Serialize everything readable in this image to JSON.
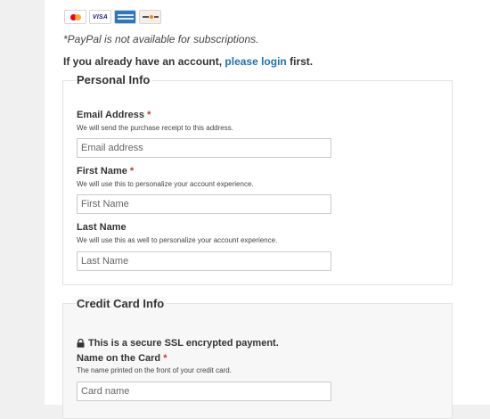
{
  "payment_methods": [
    {
      "name": "mastercard-icon"
    },
    {
      "name": "visa-icon",
      "text": "VISA"
    },
    {
      "name": "amex-icon"
    },
    {
      "name": "discover-icon"
    }
  ],
  "paypal_note": "*PayPal is not available for subscriptions.",
  "login": {
    "prefix": "If you already have an account,",
    "link": "please login",
    "suffix": "first."
  },
  "personal_info": {
    "title": "Personal Info",
    "fields": [
      {
        "label": "Email Address",
        "required": "*",
        "description": "We will send the purchase receipt to this address.",
        "placeholder": "Email address"
      },
      {
        "label": "First Name",
        "required": "*",
        "description": "We will use this to personalize your account experience.",
        "placeholder": "First Name"
      },
      {
        "label": "Last Name",
        "description": "We will use this as well to personalize your account experience.",
        "placeholder": "Last Name"
      }
    ]
  },
  "credit_card_info": {
    "title": "Credit Card Info",
    "ssl_note": "This is a secure SSL encrypted payment.",
    "fields": [
      {
        "label": "Name on the Card",
        "required": "*",
        "description": "The name printed on the front of your credit card.",
        "placeholder": "Card name"
      }
    ]
  },
  "colors": {
    "link": "#2271b1",
    "required": "#c0392b",
    "credit_section_bg": "#f7f7f7"
  }
}
